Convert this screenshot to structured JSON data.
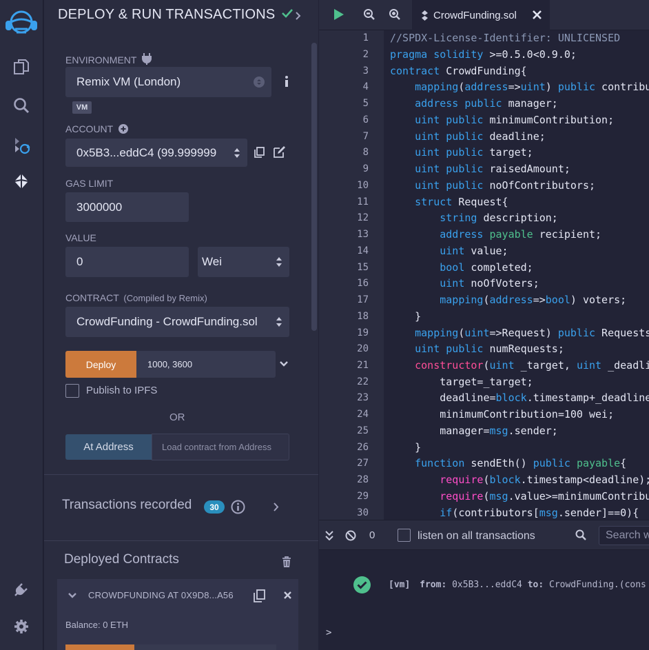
{
  "panel": {
    "title": "DEPLOY & RUN TRANSACTIONS",
    "environment_label": "ENVIRONMENT",
    "environment_value": "Remix VM (London)",
    "vm_badge": "VM",
    "account_label": "ACCOUNT",
    "account_value": "0x5B3...eddC4 (99.999999",
    "gas_limit_label": "GAS LIMIT",
    "gas_limit_value": "3000000",
    "value_label": "VALUE",
    "value_value": "0",
    "value_unit": "Wei",
    "contract_label": "CONTRACT",
    "contract_sub": "(Compiled by Remix)",
    "contract_value": "CrowdFunding - CrowdFunding.sol",
    "deploy_label": "Deploy",
    "deploy_args": "1000, 3600",
    "publish_label": "Publish to IPFS",
    "or_label": "OR",
    "at_address_label": "At Address",
    "at_address_placeholder": "Load contract from Address",
    "tx_recorded_label": "Transactions recorded",
    "tx_recorded_count": "30",
    "deployed_label": "Deployed Contracts",
    "instance_title": "CROWDFUNDING AT 0X9D8...A56",
    "instance_balance": "Balance: 0 ETH"
  },
  "editor": {
    "tab_name": "CrowdFunding.sol",
    "line_numbers": [
      "1",
      "2",
      "3",
      "4",
      "5",
      "6",
      "7",
      "8",
      "9",
      "10",
      "11",
      "12",
      "13",
      "14",
      "15",
      "16",
      "17",
      "18",
      "19",
      "20",
      "21",
      "22",
      "23",
      "24",
      "25",
      "26",
      "27",
      "28",
      "29",
      "30"
    ]
  },
  "terminal": {
    "pending_count": "0",
    "listen_label": "listen on all transactions",
    "search_placeholder": "Search w",
    "log_tag": "[vm]",
    "log_from_label": "from:",
    "log_from": "0x5B3...eddC4",
    "log_to_label": "to:",
    "log_to": "CrowdFunding.(cons",
    "prompt": ">"
  },
  "colors": {
    "accent": "#cc7a3c",
    "success": "#4fc08d",
    "info": "#2a8fbd"
  },
  "icons": [
    "remix-logo-icon",
    "file-explorer-icon",
    "search-icon",
    "compile-icon",
    "deploy-icon",
    "plugin-icon",
    "settings-icon",
    "run-icon",
    "zoom-out-icon",
    "zoom-in-icon",
    "solidity-file-icon",
    "close-icon"
  ]
}
